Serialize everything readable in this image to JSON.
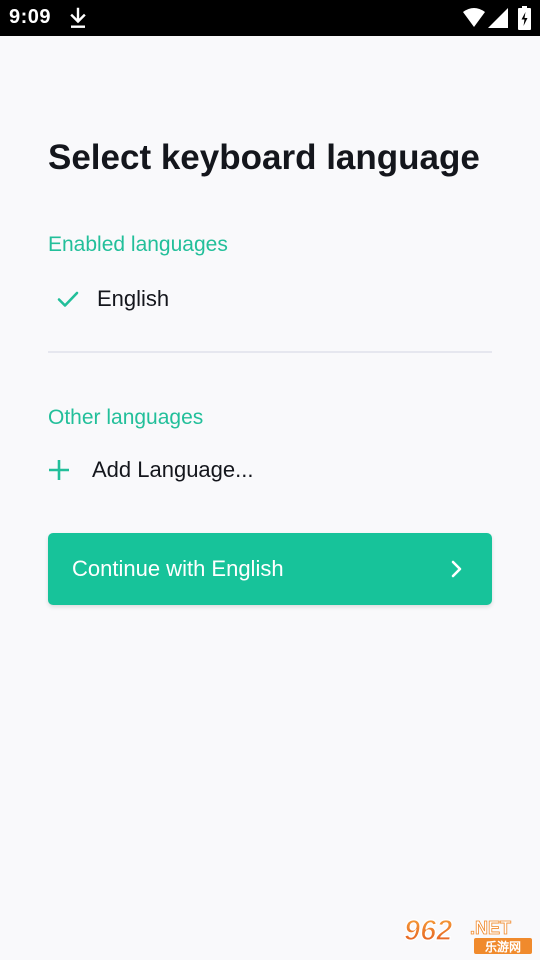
{
  "status_bar": {
    "time": "9:09",
    "icons": [
      "download-icon",
      "wifi-icon",
      "signal-icon",
      "battery-icon"
    ]
  },
  "page": {
    "title": "Select keyboard language"
  },
  "enabled_section": {
    "label": "Enabled languages",
    "items": [
      {
        "label": "English",
        "icon": "check-icon"
      }
    ]
  },
  "other_section": {
    "label": "Other languages",
    "add_label": "Add Language...",
    "add_icon": "plus-icon"
  },
  "continue_button": {
    "label": "Continue with English",
    "icon": "chevron-right-icon"
  },
  "watermark": {
    "text": "962.NET",
    "subtext": "乐游网"
  },
  "colors": {
    "accent": "#22bf9a",
    "button": "#17c39a",
    "title": "#14161c",
    "background": "#f9f9fb",
    "divider": "#e6e7ef"
  }
}
